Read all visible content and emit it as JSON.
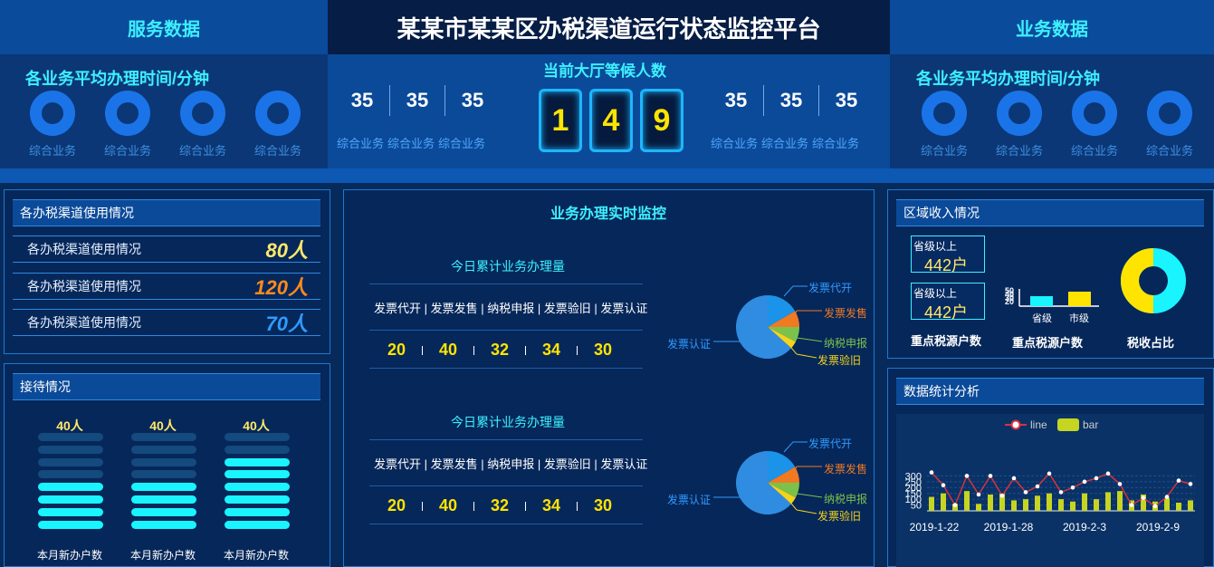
{
  "header": {
    "left_title": "服务数据",
    "center_title": "某某市某某区办税渠道运行状态监控平台",
    "right_title": "业务数据"
  },
  "left_band": {
    "title": "各业务平均办理时间/分钟",
    "rings": [
      "综合业务",
      "综合业务",
      "综合业务",
      "综合业务"
    ]
  },
  "right_band": {
    "title": "各业务平均办理时间/分钟",
    "rings": [
      "综合业务",
      "综合业务",
      "综合业务",
      "综合业务"
    ]
  },
  "center_band": {
    "title": "当前大厅等候人数",
    "left_stats": [
      {
        "value": "35",
        "label": "综合业务"
      },
      {
        "value": "35",
        "label": "综合业务"
      },
      {
        "value": "35",
        "label": "综合业务"
      }
    ],
    "digits": [
      "1",
      "4",
      "9"
    ],
    "right_stats": [
      {
        "value": "35",
        "label": "综合业务"
      },
      {
        "value": "35",
        "label": "综合业务"
      },
      {
        "value": "35",
        "label": "综合业务"
      }
    ]
  },
  "channel_usage": {
    "title": "各办税渠道使用情况",
    "rows": [
      {
        "label": "各办税渠道使用情况",
        "value": "80人",
        "color": "#ffe96a"
      },
      {
        "label": "各办税渠道使用情况",
        "value": "120人",
        "color": "#ff8a1f"
      },
      {
        "label": "各办税渠道使用情况",
        "value": "70人",
        "color": "#2f9bff"
      }
    ]
  },
  "reception": {
    "title": "接待情况",
    "columns": [
      {
        "count": "40人",
        "label": "本月新办户数",
        "level": 0.4
      },
      {
        "count": "40人",
        "label": "本月新办户数",
        "level": 0.4
      },
      {
        "count": "40人",
        "label": "本月新办户数",
        "level": 0.6
      }
    ]
  },
  "monitor": {
    "title": "业务办理实时监控",
    "blocks": [
      {
        "subtitle": "今日累计业务办理量",
        "categories": "发票代开 | 发票发售 | 纳税申报 | 发票验旧 | 发票认证",
        "values": [
          "20",
          "40",
          "32",
          "34",
          "30"
        ]
      },
      {
        "subtitle": "今日累计业务办理量",
        "categories": "发票代开 | 发票发售 | 纳税申报 | 发票验旧 | 发票认证",
        "values": [
          "20",
          "40",
          "32",
          "34",
          "30"
        ]
      }
    ],
    "pie_labels": {
      "daikai": "发票代开",
      "fashou": "发票发售",
      "shenbao": "纳税申报",
      "yanjiu": "发票验旧",
      "renzheng": "发票认证"
    },
    "pie_colors": [
      "#1b93e8",
      "#f07a22",
      "#7cc24a",
      "#f4d31c",
      "#2f8ce0"
    ]
  },
  "region_income": {
    "title": "区域收入情况",
    "boxes": [
      {
        "label": "省级以上",
        "value": "442户"
      },
      {
        "label": "省级以上",
        "value": "442户"
      }
    ],
    "box_caption": "重点税源户数",
    "bar_caption": "重点税源户数",
    "bar_ticks": [
      "50",
      "40",
      "30",
      "20"
    ],
    "bar_categories": [
      "省级",
      "市级"
    ],
    "bar_colors": [
      "#19f4ff",
      "#ffe400"
    ],
    "donut_caption": "税收占比",
    "donut_colors": [
      "#ffe400",
      "#19f4ff"
    ]
  },
  "stats_analysis": {
    "title": "数据统计分析",
    "legend_line": "line",
    "legend_bar": "bar"
  },
  "chart_data": {
    "type": "bar",
    "x_ticks": [
      "2019-1-22",
      "2019-1-28",
      "2019-2-3",
      "2019-2-9"
    ],
    "y_ticks": [
      "300",
      "250",
      "200",
      "150",
      "100",
      "50"
    ],
    "ylim": [
      0,
      350
    ],
    "series": [
      {
        "name": "line",
        "values": [
          330,
          220,
          50,
          300,
          140,
          300,
          130,
          280,
          160,
          210,
          320,
          160,
          200,
          250,
          280,
          320,
          230,
          50,
          110,
          40,
          120,
          260,
          230
        ]
      },
      {
        "name": "bar",
        "values": [
          120,
          150,
          60,
          170,
          60,
          140,
          150,
          90,
          100,
          130,
          150,
          100,
          80,
          150,
          100,
          160,
          170,
          90,
          140,
          80,
          110,
          70,
          90
        ]
      }
    ],
    "colors": {
      "line": "#d6333c",
      "bar": "#c5d522"
    }
  }
}
